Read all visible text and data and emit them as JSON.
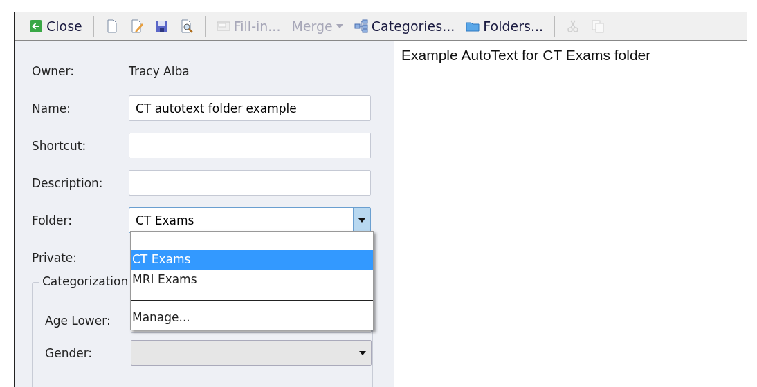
{
  "toolbar": [
    {
      "kind": "button",
      "label": "Close",
      "disabled": false
    },
    {
      "kind": "separator"
    },
    {
      "kind": "button"
    },
    {
      "kind": "button"
    },
    {
      "kind": "button"
    },
    {
      "kind": "button"
    },
    {
      "kind": "separator"
    },
    {
      "kind": "button",
      "label": "Fill-in...",
      "disabled": true
    },
    {
      "kind": "menu",
      "label": "Merge",
      "disabled": true
    },
    {
      "kind": "button",
      "label": "Categories...",
      "disabled": false
    },
    {
      "kind": "button",
      "label": "Folders...",
      "disabled": false
    },
    {
      "kind": "separator"
    },
    {
      "kind": "button",
      "disabled": true
    },
    {
      "kind": "button",
      "disabled": true
    }
  ],
  "form": {
    "fields": [
      {
        "kind": "static",
        "label": "Owner:",
        "value": "Tracy Alba"
      },
      {
        "kind": "text",
        "label": "Name:",
        "value": "CT autotext folder example"
      },
      {
        "kind": "text",
        "label": "Shortcut:"
      },
      {
        "kind": "text",
        "label": "Description:"
      },
      {
        "kind": "combo",
        "label": "Folder:",
        "value": "CT Exams",
        "expanded": true,
        "options": [
          {
            "label": "CT Exams",
            "selected": true
          },
          {
            "label": "MRI Exams",
            "selected": false
          }
        ],
        "action": "Manage..."
      },
      {
        "kind": "check",
        "label": "Private:"
      }
    ],
    "group": {
      "title": "Categorization",
      "fields": [
        {
          "kind": "text",
          "label": "Age Lower:"
        },
        {
          "kind": "combo",
          "label": "Gender:",
          "expanded": false
        }
      ]
    }
  },
  "editor": {
    "text": "Example AutoText for CT Exams folder"
  }
}
